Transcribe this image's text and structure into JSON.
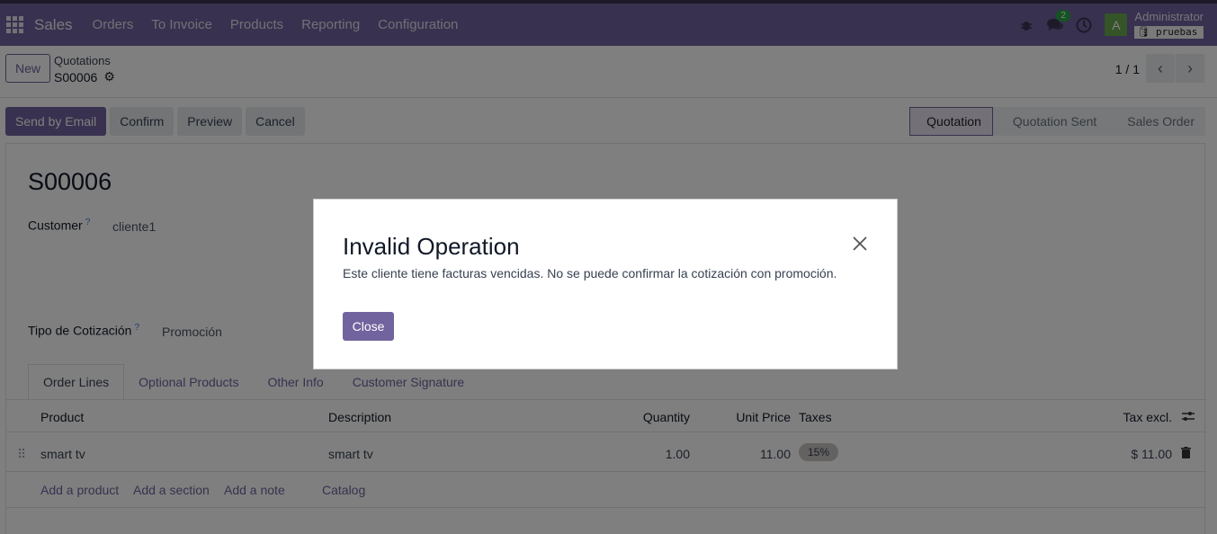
{
  "navbar": {
    "app_name": "Sales",
    "menu": [
      "Orders",
      "To Invoice",
      "Products",
      "Reporting",
      "Configuration"
    ],
    "messages_count": "2",
    "avatar_letter": "A",
    "user_name": "Administrator",
    "database": "pruebas",
    "accent_color": "#71639e"
  },
  "control": {
    "new_label": "New",
    "breadcrumb_parent": "Quotations",
    "breadcrumb_current": "S00006",
    "pager": "1 / 1"
  },
  "actions": {
    "send_email": "Send by Email",
    "confirm": "Confirm",
    "preview": "Preview",
    "cancel": "Cancel"
  },
  "stages": [
    "Quotation",
    "Quotation Sent",
    "Sales Order"
  ],
  "record": {
    "name": "S00006",
    "customer_label": "Customer",
    "customer_value": "cliente1",
    "tipo_label": "Tipo de Cotización",
    "tipo_value": "Promoción",
    "help_mark": "?"
  },
  "tabs": [
    "Order Lines",
    "Optional Products",
    "Other Info",
    "Customer Signature"
  ],
  "order_lines": {
    "columns": {
      "product": "Product",
      "description": "Description",
      "quantity": "Quantity",
      "unit_price": "Unit Price",
      "taxes": "Taxes",
      "tax_excl": "Tax excl."
    },
    "rows": [
      {
        "product": "smart tv",
        "description": "smart tv",
        "quantity": "1.00",
        "unit_price": "11.00",
        "tax": "15%",
        "subtotal": "$ 11.00"
      }
    ],
    "add_links": [
      "Add a product",
      "Add a section",
      "Add a note",
      "Catalog"
    ]
  },
  "dialog": {
    "title": "Invalid Operation",
    "message": "Este cliente tiene facturas vencidas. No se puede confirmar la cotización con promoción.",
    "close_label": "Close"
  }
}
